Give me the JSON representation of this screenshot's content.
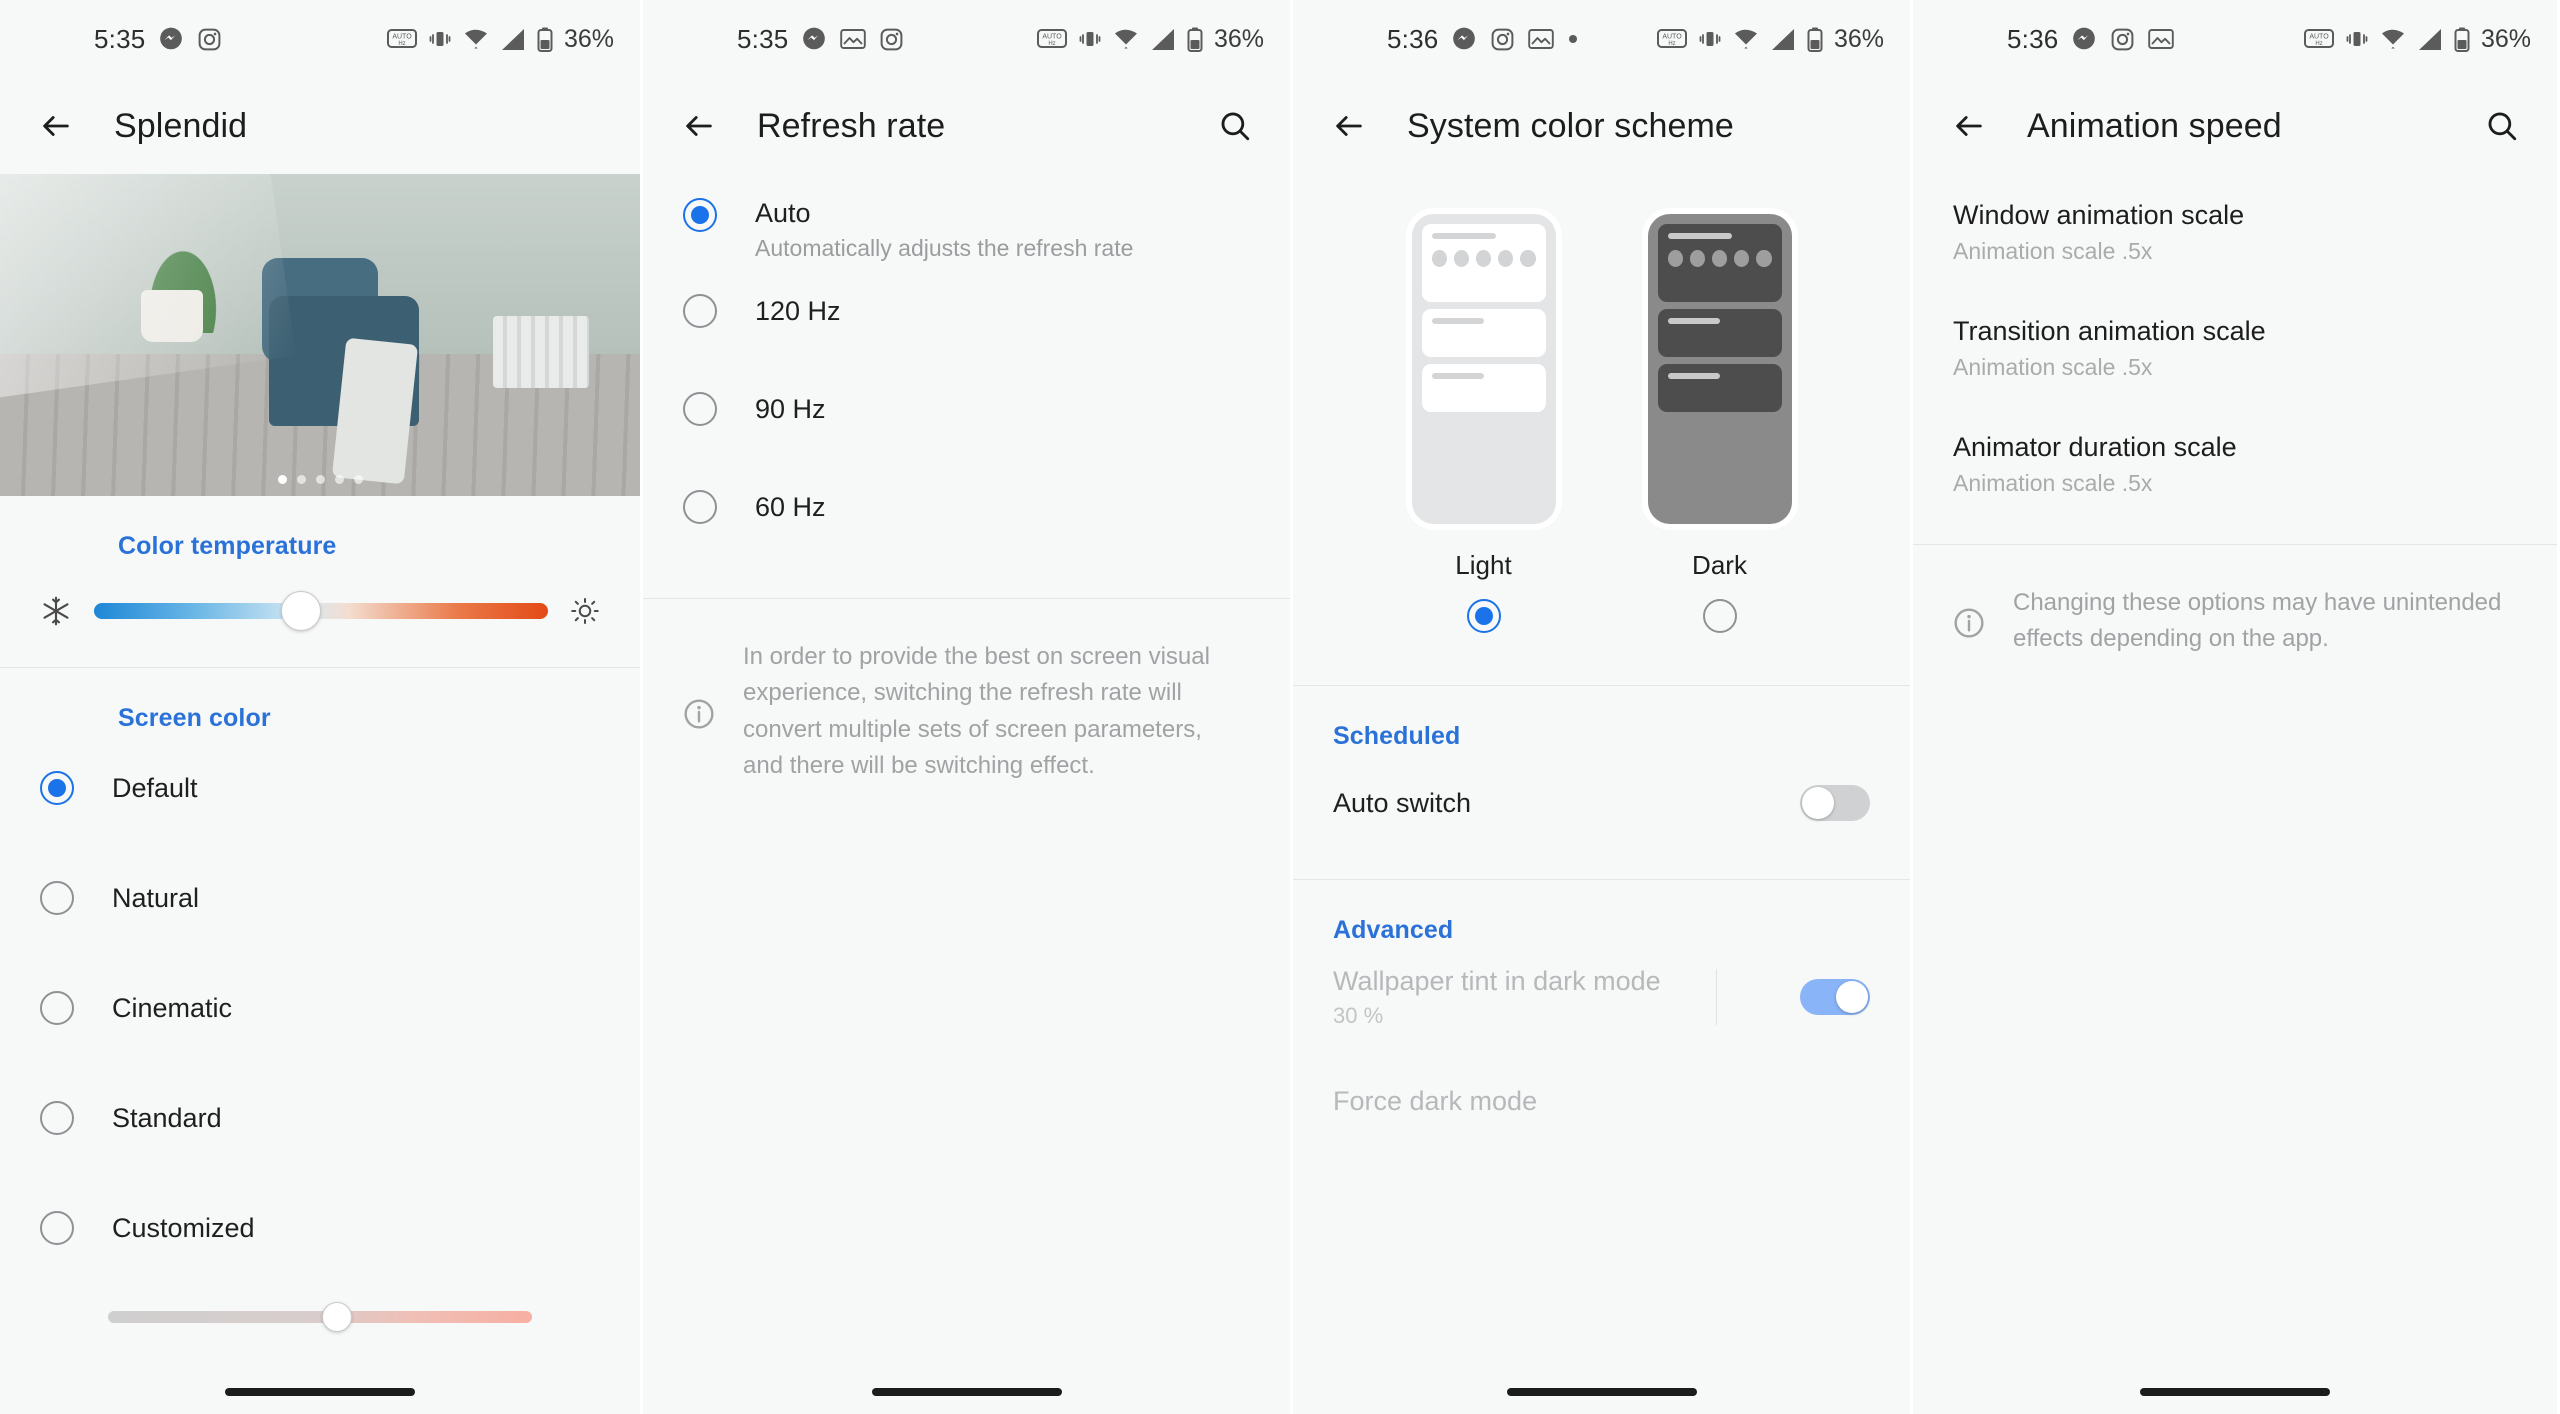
{
  "status_bars": [
    {
      "time": "5:35",
      "left_icons": [
        "messenger-icon",
        "instagram-icon"
      ],
      "right_icons": [
        "auto-hz-icon",
        "vibrate-icon",
        "wifi-icon",
        "signal-icon",
        "battery-icon"
      ],
      "battery": "36%"
    },
    {
      "time": "5:35",
      "left_icons": [
        "messenger-icon",
        "photos-icon",
        "instagram-icon"
      ],
      "right_icons": [
        "auto-hz-icon",
        "vibrate-icon",
        "wifi-icon",
        "signal-icon",
        "battery-icon"
      ],
      "battery": "36%"
    },
    {
      "time": "5:36",
      "left_icons": [
        "messenger-icon",
        "instagram-icon",
        "photos-icon",
        "dot-icon"
      ],
      "right_icons": [
        "auto-hz-icon",
        "vibrate-icon",
        "wifi-icon",
        "signal-icon",
        "battery-icon"
      ],
      "battery": "36%"
    },
    {
      "time": "5:36",
      "left_icons": [
        "messenger-icon",
        "instagram-icon",
        "photos-icon"
      ],
      "right_icons": [
        "auto-hz-icon",
        "vibrate-icon",
        "wifi-icon",
        "signal-icon",
        "battery-icon"
      ],
      "battery": "36%"
    }
  ],
  "colors": {
    "accent_blue": "#2b72d8",
    "radio_blue": "#1a73e8",
    "toggle_on": "#8ab4f8",
    "toggle_off": "#cfd1d3",
    "page_bg": "#f7f8f8",
    "primary_text": "#1d1d1d",
    "secondary_text": "#a0a2a4"
  },
  "panel1": {
    "title": "Splendid",
    "back_icon": "back-arrow-icon",
    "carousel": {
      "slide_count": 5,
      "active_index": 0
    },
    "color_temperature": {
      "heading": "Color temperature",
      "left_icon": "snowflake-icon",
      "right_icon": "sun-icon",
      "value_percent": 45
    },
    "screen_color": {
      "heading": "Screen color",
      "options": [
        {
          "label": "Default",
          "selected": true
        },
        {
          "label": "Natural",
          "selected": false
        },
        {
          "label": "Cinematic",
          "selected": false
        },
        {
          "label": "Standard",
          "selected": false
        },
        {
          "label": "Customized",
          "selected": false
        }
      ],
      "customized_slider_percent": 54
    }
  },
  "panel2": {
    "title": "Refresh rate",
    "back_icon": "back-arrow-icon",
    "search_icon": "search-icon",
    "options": [
      {
        "label": "Auto",
        "sub": "Automatically adjusts the refresh rate",
        "selected": true
      },
      {
        "label": "120 Hz",
        "sub": "",
        "selected": false
      },
      {
        "label": "90 Hz",
        "sub": "",
        "selected": false
      },
      {
        "label": "60 Hz",
        "sub": "",
        "selected": false
      }
    ],
    "info_icon": "info-icon",
    "info": "In order to provide the best on screen visual experience, switching the refresh rate will convert multiple sets of screen parameters, and there will be switching effect."
  },
  "panel3": {
    "title": "System color scheme",
    "back_icon": "back-arrow-icon",
    "schemes": [
      {
        "label": "Light",
        "selected": true
      },
      {
        "label": "Dark",
        "selected": false
      }
    ],
    "scheduled": {
      "heading": "Scheduled",
      "auto_switch_label": "Auto switch",
      "auto_switch_on": false
    },
    "advanced": {
      "heading": "Advanced",
      "wallpaper_tint_label": "Wallpaper tint in dark mode",
      "wallpaper_tint_value": "30 %",
      "wallpaper_tint_on": true,
      "force_dark_label": "Force dark mode"
    }
  },
  "panel4": {
    "title": "Animation speed",
    "back_icon": "back-arrow-icon",
    "search_icon": "search-icon",
    "items": [
      {
        "title": "Window animation scale",
        "sub": "Animation scale .5x"
      },
      {
        "title": "Transition animation scale",
        "sub": "Animation scale .5x"
      },
      {
        "title": "Animator duration scale",
        "sub": "Animation scale .5x"
      }
    ],
    "info_icon": "info-icon",
    "info": "Changing these options may have unintended effects depending on the app."
  }
}
